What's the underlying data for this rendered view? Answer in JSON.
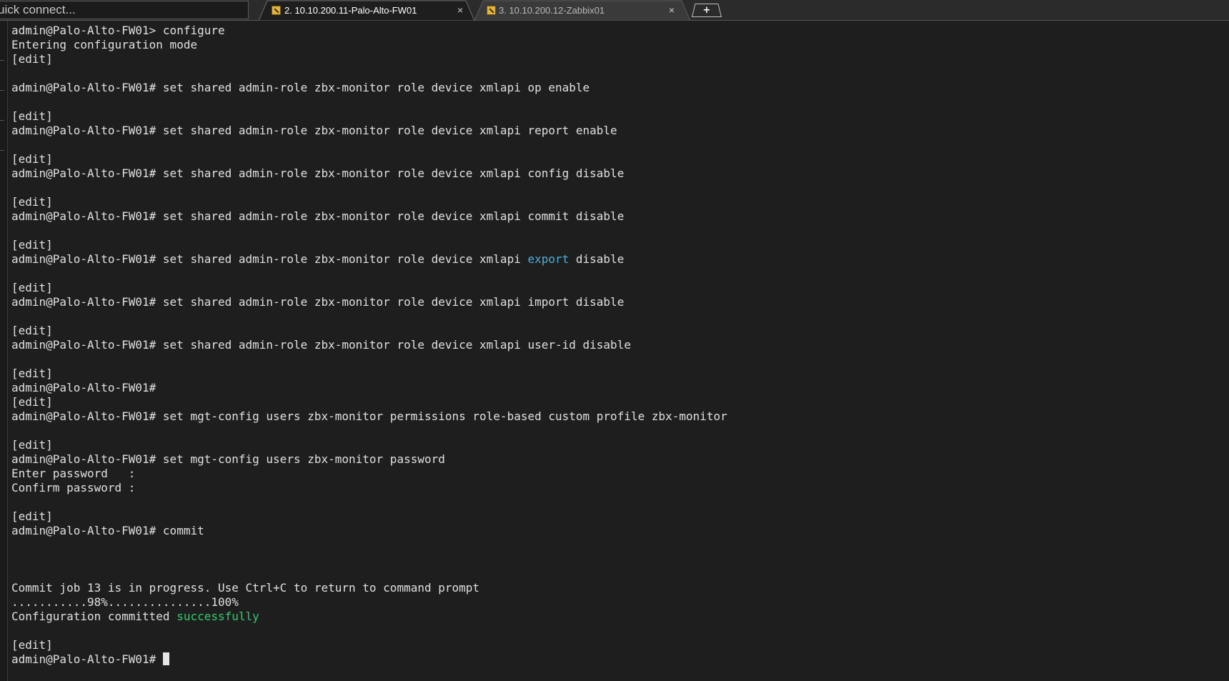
{
  "quick_connect": {
    "placeholder": "uick connect..."
  },
  "tabs": [
    {
      "label": "2. 10.10.200.11-Palo-Alto-FW01",
      "close": "×",
      "active": true,
      "icon": "terminal-session-icon"
    },
    {
      "label": "3. 10.10.200.12-Zabbix01",
      "close": "×",
      "active": false,
      "icon": "terminal-session-icon"
    }
  ],
  "new_tab": {
    "label": "+",
    "icon": "plus-icon"
  },
  "colors": {
    "background": "#1e1e1e",
    "text": "#e0e0e0",
    "highlight_cyan": "#4fb0d8",
    "highlight_green": "#2ecc71",
    "tab_bar": "#2b2b2b",
    "active_tab": "#1e1e1e",
    "inactive_tab": "#3a3a3a",
    "session_icon": "#e3b341"
  },
  "terminal": {
    "lines": [
      "admin@Palo-Alto-FW01> configure",
      "Entering configuration mode",
      "[edit]",
      "",
      "admin@Palo-Alto-FW01# set shared admin-role zbx-monitor role device xmlapi op enable",
      "",
      "[edit]",
      "admin@Palo-Alto-FW01# set shared admin-role zbx-monitor role device xmlapi report enable",
      "",
      "[edit]",
      "admin@Palo-Alto-FW01# set shared admin-role zbx-monitor role device xmlapi config disable",
      "",
      "[edit]",
      "admin@Palo-Alto-FW01# set shared admin-role zbx-monitor role device xmlapi commit disable",
      "",
      "[edit]",
      {
        "prefix": "admin@Palo-Alto-FW01# set shared admin-role zbx-monitor role device xmlapi ",
        "highlight": "export",
        "suffix": " disable",
        "color": "cyan"
      },
      "",
      "[edit]",
      "admin@Palo-Alto-FW01# set shared admin-role zbx-monitor role device xmlapi import disable",
      "",
      "[edit]",
      "admin@Palo-Alto-FW01# set shared admin-role zbx-monitor role device xmlapi user-id disable",
      "",
      "[edit]",
      "admin@Palo-Alto-FW01#",
      "[edit]",
      "admin@Palo-Alto-FW01# set mgt-config users zbx-monitor permissions role-based custom profile zbx-monitor",
      "",
      "[edit]",
      "admin@Palo-Alto-FW01# set mgt-config users zbx-monitor password",
      "Enter password   :",
      "Confirm password :",
      "",
      "[edit]",
      "admin@Palo-Alto-FW01# commit",
      "",
      "",
      "",
      "Commit job 13 is in progress. Use Ctrl+C to return to command prompt",
      "...........98%...............100%",
      {
        "prefix": "Configuration committed ",
        "highlight": "successfully",
        "suffix": "",
        "color": "green"
      },
      "",
      "[edit]",
      {
        "prefix": "admin@Palo-Alto-FW01# ",
        "cursor": true
      }
    ]
  }
}
